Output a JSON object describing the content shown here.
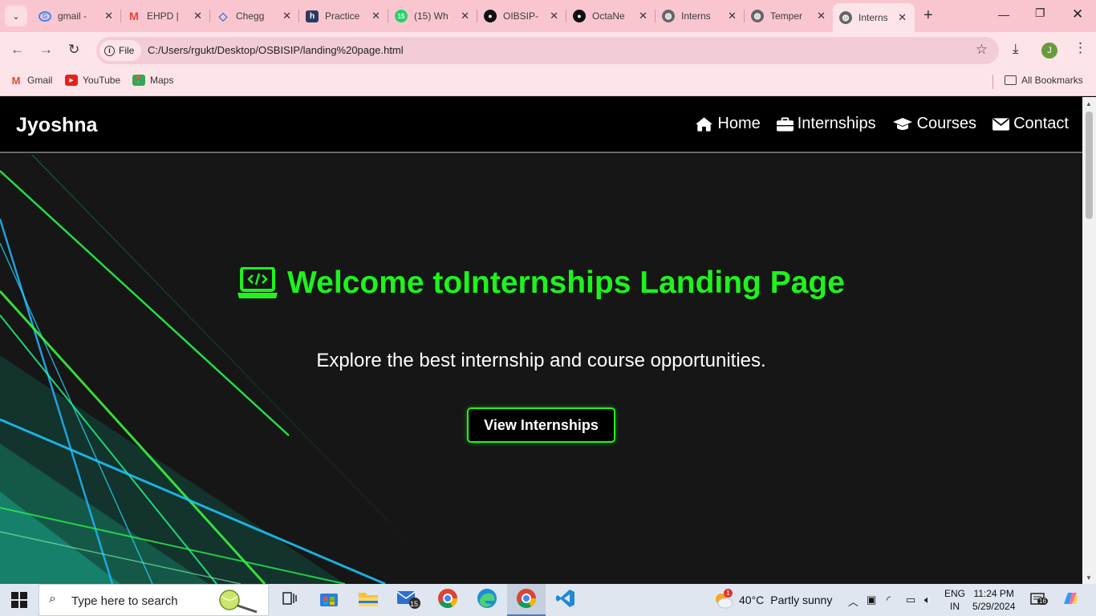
{
  "browser": {
    "tabs": [
      {
        "title": "gmail -",
        "favicon": "google-icon",
        "color": "#4285f4"
      },
      {
        "title": "EHPD |",
        "favicon": "gmail-icon",
        "color": "#ea4335"
      },
      {
        "title": "Chegg",
        "favicon": "chegg-icon",
        "color": "#4b74c6"
      },
      {
        "title": "Practice",
        "favicon": "hackerrank-icon",
        "color": "#2c3a5e"
      },
      {
        "title": "(15) Wh",
        "favicon": "whatsapp-icon",
        "color": "#25d366",
        "badge": "15"
      },
      {
        "title": "OIBSIP-",
        "favicon": "github-icon",
        "color": "#111111"
      },
      {
        "title": "OctaNe",
        "favicon": "github-icon",
        "color": "#111111"
      },
      {
        "title": "Interns",
        "favicon": "globe-icon",
        "color": "#555555"
      },
      {
        "title": "Temper",
        "favicon": "globe-icon",
        "color": "#555555"
      },
      {
        "title": "Interns",
        "favicon": "globe-icon",
        "color": "#555555",
        "active": true
      }
    ],
    "address": {
      "chip_label": "File",
      "url": "C:/Users/rgukt/Desktop/OSBISIP/landing%20page.html"
    },
    "profile_initial": "J",
    "bookmarks": [
      {
        "label": "Gmail",
        "icon": "gmail-icon"
      },
      {
        "label": "YouTube",
        "icon": "youtube-icon"
      },
      {
        "label": "Maps",
        "icon": "maps-icon"
      }
    ],
    "all_bookmarks_label": "All Bookmarks"
  },
  "site": {
    "brand": "Jyoshna",
    "nav": [
      {
        "label": "Home",
        "icon": "home-icon"
      },
      {
        "label": "Internships",
        "icon": "briefcase-icon"
      },
      {
        "label": "Courses",
        "icon": "graduation-cap-icon"
      },
      {
        "label": "Contact",
        "icon": "envelope-icon"
      }
    ],
    "hero": {
      "title": "Welcome toInternships Landing Page",
      "subtitle": "Explore the best internship and course opportunities.",
      "cta_label": "View Internships"
    },
    "colors": {
      "accent": "#1df41d",
      "header_bg": "#000000",
      "hero_bg": "#161616"
    }
  },
  "taskbar": {
    "search_placeholder": "Type here to search",
    "mail_badge": "15",
    "weather": {
      "temp": "40°C",
      "condition": "Partly sunny",
      "alert": "1"
    },
    "language": {
      "line1": "ENG",
      "line2": "IN"
    },
    "clock": {
      "time": "11:24 PM",
      "date": "5/29/2024"
    },
    "notifications_count": "16"
  }
}
